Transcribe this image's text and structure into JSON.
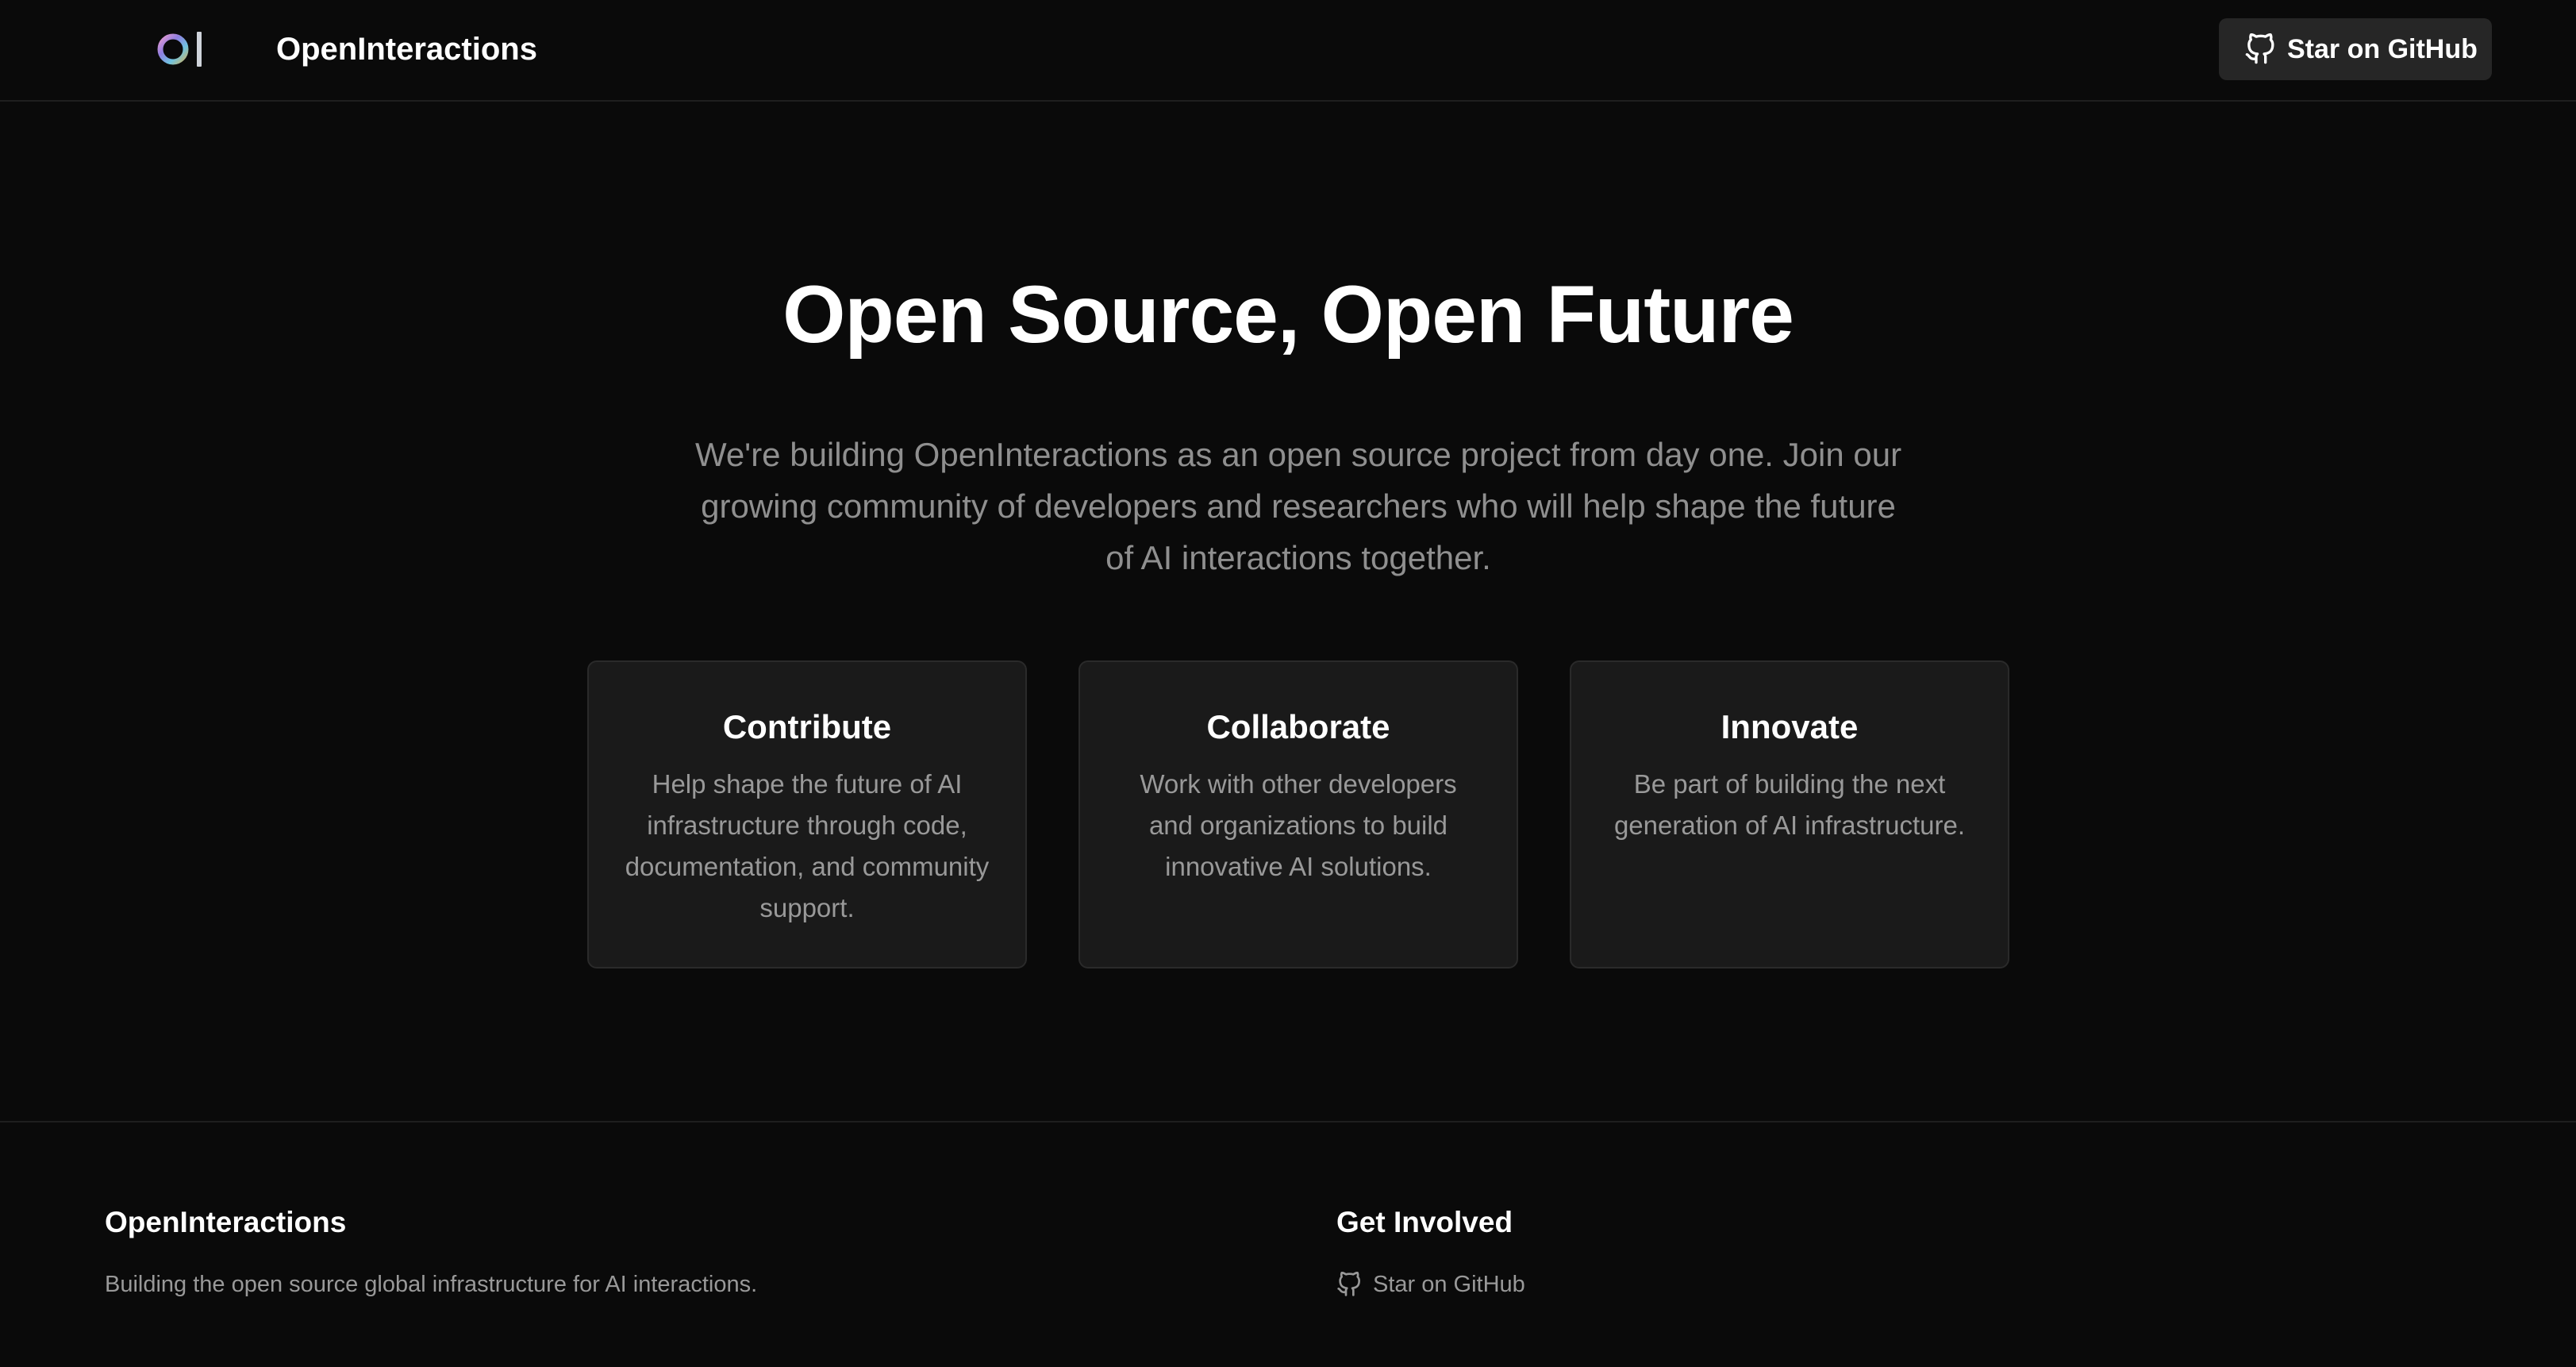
{
  "header": {
    "logo_icon": "openinteractions-logo-icon",
    "brand": "OpenInteractions",
    "github_button_label": "Star on GitHub",
    "github_icon": "github-icon"
  },
  "hero": {
    "title": "Open Source, Open Future",
    "description": "We're building OpenInteractions as an open source project from day one. Join our growing community of developers and researchers who will help shape the future of AI interactions together."
  },
  "cards": [
    {
      "title": "Contribute",
      "text": "Help shape the future of AI infrastructure through code, documentation, and community support."
    },
    {
      "title": "Collaborate",
      "text": "Work with other developers and organizations to build innovative AI solutions."
    },
    {
      "title": "Innovate",
      "text": "Be part of building the next generation of AI infrastructure."
    }
  ],
  "footer": {
    "brand": "OpenInteractions",
    "description": "Building the open source global infrastructure for AI interactions.",
    "get_involved_heading": "Get Involved",
    "github_link_label": "Star on GitHub",
    "github_icon": "github-icon"
  },
  "colors": {
    "background": "#0a0a0a",
    "card_background": "#1a1a1a",
    "button_background": "#262626",
    "muted_text": "#999999"
  }
}
